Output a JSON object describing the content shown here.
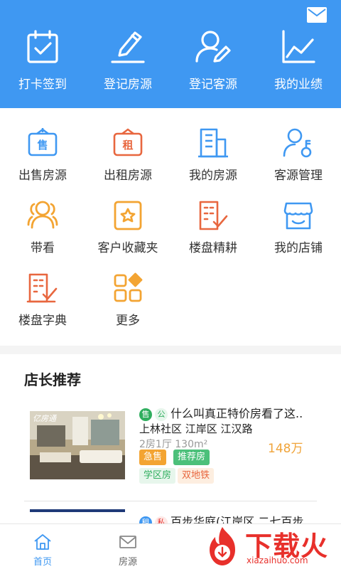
{
  "colors": {
    "primary": "#3f98f2",
    "price": "#f0a43a",
    "watermark": "#e8302b"
  },
  "header": {
    "actions": [
      {
        "label": "打卡签到",
        "icon": "calendar-check-icon"
      },
      {
        "label": "登记房源",
        "icon": "pen-icon"
      },
      {
        "label": "登记客源",
        "icon": "user-pen-icon"
      },
      {
        "label": "我的业绩",
        "icon": "line-chart-icon"
      }
    ]
  },
  "grid": {
    "items": [
      {
        "label": "出售房源",
        "icon": "sale-sign-icon",
        "sign": "售"
      },
      {
        "label": "出租房源",
        "icon": "rent-sign-icon",
        "sign": "租"
      },
      {
        "label": "我的房源",
        "icon": "buildings-icon"
      },
      {
        "label": "客源管理",
        "icon": "user-key-icon"
      },
      {
        "label": "带看",
        "icon": "people-icon"
      },
      {
        "label": "客户收藏夹",
        "icon": "star-box-icon"
      },
      {
        "label": "楼盘精耕",
        "icon": "building-check-icon"
      },
      {
        "label": "我的店铺",
        "icon": "shop-icon"
      },
      {
        "label": "楼盘字典",
        "icon": "building-list-icon"
      },
      {
        "label": "更多",
        "icon": "more-grid-icon"
      }
    ]
  },
  "recommend": {
    "title": "店长推荐",
    "items": [
      {
        "badge1": "售",
        "badge2": "公",
        "title": "什么叫真正特价房看了这..",
        "location": "上林社区 江岸区 江汉路",
        "meta": "2房1厅 130m²",
        "price": "148万",
        "tags": [
          "急售",
          "推荐房"
        ],
        "tags2": [
          "学区房",
          "双地铁"
        ],
        "thumb_logo": "亿房通"
      },
      {
        "badge1": "租",
        "badge2": "私",
        "title": "百步华庭(江岸区 二七百步"
      }
    ]
  },
  "bottom_nav": {
    "items": [
      {
        "label": "首页",
        "icon": "home-icon",
        "active": true
      },
      {
        "label": "房源",
        "icon": "mail-icon",
        "active": false
      }
    ]
  },
  "watermark": {
    "text": "下载火",
    "url": "xiazaihuo.com"
  }
}
